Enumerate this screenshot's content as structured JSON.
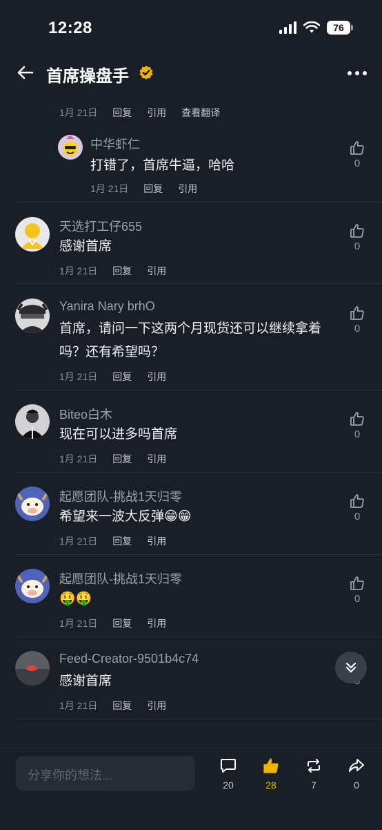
{
  "status_bar": {
    "time": "12:28",
    "battery": "76"
  },
  "header": {
    "title": "首席操盘手"
  },
  "comments": [
    {
      "reply_meta": {
        "date": "1月 21日",
        "reply": "回复",
        "quote": "引用",
        "translate": "查看翻译"
      }
    },
    {
      "author": "中华虾仁",
      "text": "打错了，首席牛逼，哈哈",
      "date": "1月 21日",
      "reply": "回复",
      "quote": "引用",
      "likes": "0"
    },
    {
      "author": "天选打工仔655",
      "text": "感谢首席",
      "date": "1月 21日",
      "reply": "回复",
      "quote": "引用",
      "likes": "0"
    },
    {
      "author": "Yanira Nary brhO",
      "text_line1": "首席，请问一下这两个月现货还可以继续拿着",
      "text_line2": "吗？还有希望吗？",
      "date": "1月 21日",
      "reply": "回复",
      "quote": "引用",
      "likes": "0"
    },
    {
      "author": "Biteo白木",
      "text": "现在可以进多吗首席",
      "date": "1月 21日",
      "reply": "回复",
      "quote": "引用",
      "likes": "0"
    },
    {
      "author": "起愿团队-挑战1天归零",
      "text": "希望来一波大反弹😁😁",
      "date": "1月 21日",
      "reply": "回复",
      "quote": "引用",
      "likes": "0"
    },
    {
      "author": "起愿团队-挑战1天归零",
      "text": "🤑🤑",
      "date": "1月 21日",
      "reply": "回复",
      "quote": "引用",
      "likes": "0"
    },
    {
      "author": "Feed-Creator-9501b4c74",
      "text": "感谢首席",
      "date": "1月 21日",
      "reply": "回复",
      "quote": "引用",
      "likes": "0"
    }
  ],
  "bottom_bar": {
    "placeholder": "分享你的想法...",
    "comments_count": "20",
    "likes_count": "28",
    "reposts_count": "7",
    "shares_count": "0"
  },
  "icons": [
    "back-arrow-icon",
    "verified-badge-icon",
    "more-icon",
    "thumbs-up-icon",
    "scroll-down-icon",
    "comment-icon",
    "repost-icon",
    "share-icon"
  ],
  "colors": {
    "background": "#1a1f27",
    "accent_like": "#f0b400",
    "verified": "#f0b400"
  }
}
